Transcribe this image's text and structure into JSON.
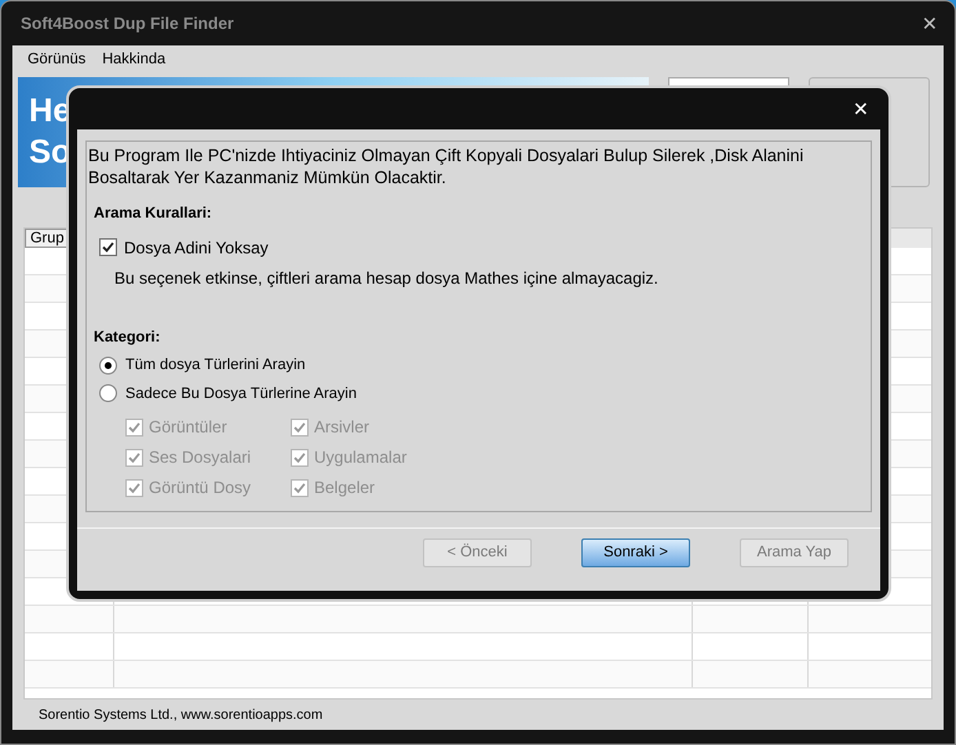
{
  "window": {
    "title": "Soft4Boost Dup File Finder",
    "close": "✕"
  },
  "menu": [
    {
      "label": "Görünüs"
    },
    {
      "label": "Hakkinda"
    }
  ],
  "banner": {
    "lines": [
      "He",
      "So"
    ]
  },
  "table": {
    "columns": [
      "Grup"
    ]
  },
  "status_bar": "Sorentio Systems Ltd., www.sorentioapps.com",
  "dialog": {
    "close": "✕",
    "intro": "Bu Program Ile PC'nizde Ihtiyaciniz Olmayan Çift Kopyali Dosyalari Bulup Silerek ,Disk Alanini Bosaltarak Yer Kazanmaniz Mümkün Olacaktir.",
    "rules_title": "Arama Kurallari:",
    "ignore_name": {
      "label": "Dosya Adini Yoksay",
      "checked": true
    },
    "ignore_note": "Bu seçenek etkinse, çiftleri arama hesap dosya Mathes içine almayacagiz.",
    "category_title": "Kategori:",
    "radios": [
      {
        "label": "Tüm dosya Türlerini Arayin",
        "selected": true
      },
      {
        "label": "Sadece Bu Dosya Türlerine Arayin",
        "selected": false
      }
    ],
    "file_types": [
      {
        "label": "Görüntüler",
        "checked": true,
        "disabled": true
      },
      {
        "label": "Arsivler",
        "checked": true,
        "disabled": true
      },
      {
        "label": "Ses Dosyalari",
        "checked": true,
        "disabled": true
      },
      {
        "label": "Uygulamalar",
        "checked": true,
        "disabled": true
      },
      {
        "label": "Görüntü Dosy",
        "checked": true,
        "disabled": true
      },
      {
        "label": "Belgeler",
        "checked": true,
        "disabled": true
      }
    ],
    "buttons": [
      {
        "label": "< Önceki",
        "disabled": true,
        "default": false
      },
      {
        "label": "Sonraki >",
        "disabled": false,
        "default": true
      },
      {
        "label": "Arama Yap",
        "disabled": true,
        "default": false
      }
    ]
  }
}
